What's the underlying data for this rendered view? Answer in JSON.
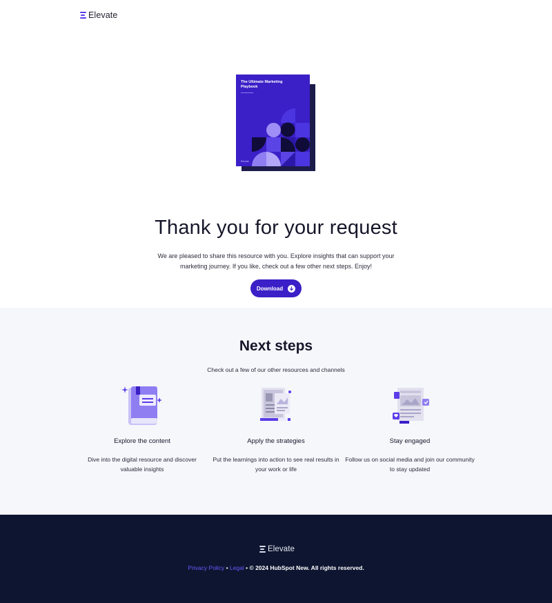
{
  "header": {
    "logo_text": "Elevate"
  },
  "hero": {
    "book_title": "The Ultimate Marketing Playbook",
    "book_brand": "Elevate",
    "title": "Thank you for your request",
    "description": "We are pleased to share this resource with you. Explore insights that can support your marketing journey. If you like, check out a few other next steps. Enjoy!",
    "download_label": "Download",
    "download_icon": "arrow-down-circle-icon"
  },
  "next_steps": {
    "title": "Next steps",
    "description": "Check out a few of our other resources and channels",
    "cards": [
      {
        "icon": "book-icon",
        "title": "Explore the content",
        "description": "Dive into the digital resource and discover valuable insights"
      },
      {
        "icon": "documents-icon",
        "title": "Apply the strategies",
        "description": "Put the learnings into action to see real results in your work or life"
      },
      {
        "icon": "social-feed-icon",
        "title": "Stay engaged",
        "description": "Follow us on social media and join our community to stay updated"
      }
    ]
  },
  "footer": {
    "logo_text": "Elevate",
    "privacy_label": "Privacy Policy",
    "legal_label": "Legal",
    "copyright": "© 2024 HubSpot New. All rights reserved."
  },
  "colors": {
    "accent": "#3b1fc7",
    "accent_light": "#6b57ff",
    "footer_bg": "#0d1530",
    "section_bg": "#f6f7fb"
  }
}
